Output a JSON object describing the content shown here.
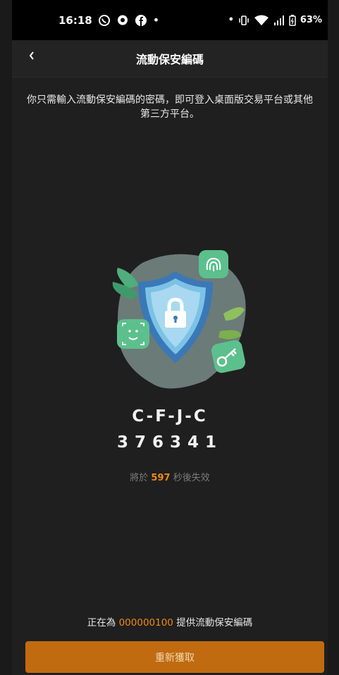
{
  "status_bar": {
    "time": "16:18",
    "battery": "63%",
    "icons": [
      "whatsapp-icon",
      "chat-bubble-icon",
      "facebook-icon",
      "vibrate-icon",
      "wifi-icon",
      "signal-icon",
      "battery-icon"
    ]
  },
  "header": {
    "title": "流動保安編碼"
  },
  "description": "你只需輸入流動保安編碼的密碼，即可登入桌面版交易平台或其他第三方平台。",
  "code": {
    "letters": "C-F-J-C",
    "digits": "376341"
  },
  "expiry": {
    "prefix": "將於 ",
    "seconds": "597",
    "suffix": " 秒後失效"
  },
  "provide": {
    "prefix": "正在為 ",
    "account": "000000100",
    "suffix": " 提供流動保安編碼"
  },
  "refresh_button": "重新獲取",
  "colors": {
    "accent": "#f08a13",
    "button": "#c06b10",
    "background": "#1f1f1f"
  }
}
